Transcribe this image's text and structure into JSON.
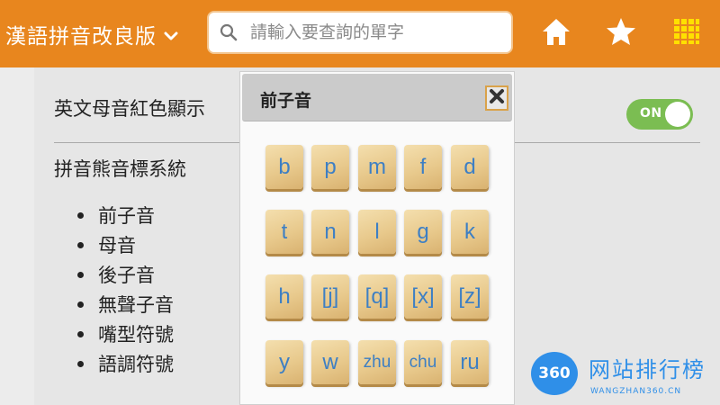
{
  "header": {
    "title": "漢語拼音改良版",
    "search_placeholder": "請輸入要查詢的單字",
    "icons": [
      "chevron-down-icon",
      "search-icon",
      "home-icon",
      "star-icon",
      "grid-icon"
    ],
    "colors": {
      "bar": "#e8861e",
      "toggle_on": "#7bbd52",
      "tile_text": "#3d7fc4"
    }
  },
  "settings": {
    "vowel_color_label": "英文母音紅色顯示",
    "toggle_label": "ON",
    "system_label": "拼音熊音標系統",
    "bullets": [
      "前子音",
      "母音",
      "後子音",
      "無聲子音",
      "嘴型符號",
      "語調符號"
    ]
  },
  "popup": {
    "title": "前子音",
    "tiles": [
      "b",
      "p",
      "m",
      "f",
      "d",
      "t",
      "n",
      "l",
      "g",
      "k",
      "h",
      "[j]",
      "[q]",
      "[x]",
      "[z]",
      "y",
      "w",
      "zhu",
      "chu",
      "ru"
    ]
  },
  "watermark": {
    "badge": "360",
    "name": "网站排行榜",
    "url": "WANGZHAN360.CN"
  }
}
